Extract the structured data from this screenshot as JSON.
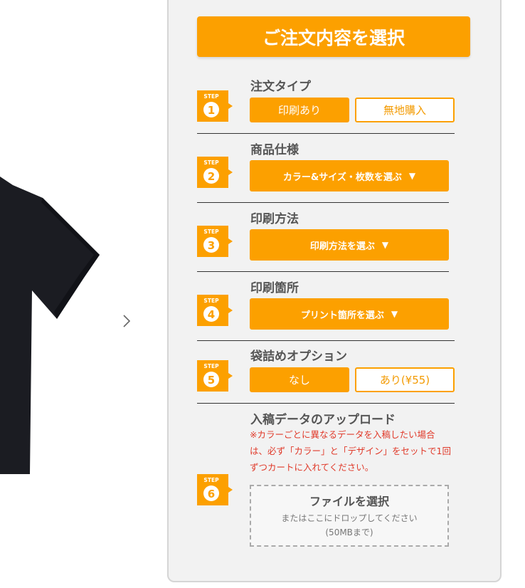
{
  "header": {
    "title": "ご注文内容を選択"
  },
  "badge_label": "STEP",
  "steps": [
    {
      "number": "1",
      "title": "注文タイプ",
      "option_selected": "印刷あり",
      "option_other": "無地購入"
    },
    {
      "number": "2",
      "title": "商品仕様",
      "select_label": "カラー&サイズ・枚数を選ぶ"
    },
    {
      "number": "3",
      "title": "印刷方法",
      "select_label": "印刷方法を選ぶ"
    },
    {
      "number": "4",
      "title": "印刷箇所",
      "select_label": "プリント箇所を選ぶ"
    },
    {
      "number": "5",
      "title": "袋詰めオプション",
      "option_selected": "なし",
      "option_other": "あり(¥55)"
    },
    {
      "number": "6",
      "title": "入稿データのアップロード",
      "notice": "※カラーごとに異なるデータを入稿したい場合は、必ず「カラー」と「デザイン」をセットで1回ずつカートに入れてください。",
      "upload_title": "ファイルを選択",
      "upload_hint": "またはここにドロップしてください",
      "upload_limit": "(50MBまで)"
    }
  ],
  "dropdown_arrow": "▼",
  "icons": {
    "next": "chevron-right-icon",
    "product": "t-shirt-image"
  },
  "colors": {
    "accent": "#fca000",
    "notice": "#e03a2a",
    "panel": "#f2f2f2"
  }
}
